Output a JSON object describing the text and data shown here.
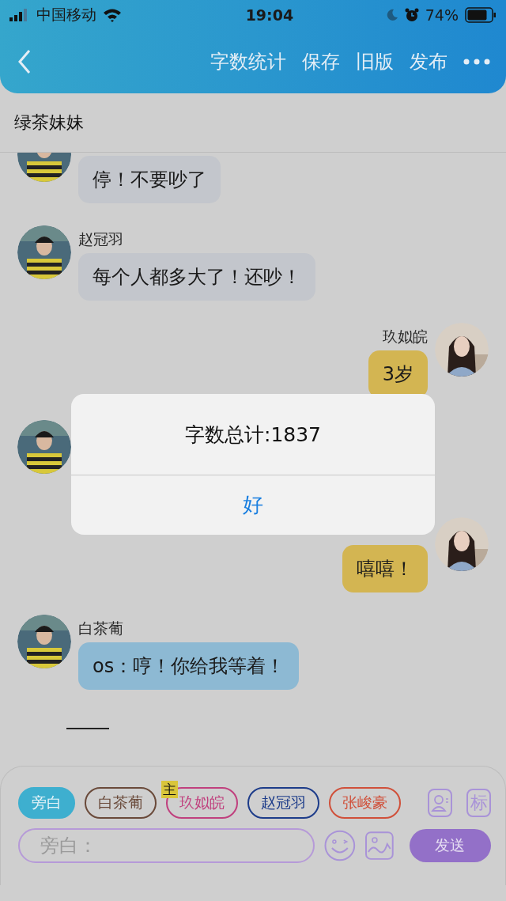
{
  "status_bar": {
    "carrier": "中国移动",
    "time": "19:04",
    "battery": "74%"
  },
  "header": {
    "actions": [
      "字数统计",
      "保存",
      "旧版",
      "发布"
    ]
  },
  "title": "绿茶妹妹",
  "messages": [
    {
      "kind": "incoming",
      "text": "停！不要吵了",
      "color": "#c3c6cc"
    },
    {
      "kind": "incoming",
      "name": "赵冠羽",
      "text": "每个人都多大了！还吵！",
      "color": "#c3c6cc"
    },
    {
      "kind": "outgoing",
      "name": "玖姒皖",
      "text": "3岁",
      "color": "#d3b552"
    },
    {
      "kind": "incoming"
    },
    {
      "kind": "outgoing",
      "text": "嘻嘻！",
      "color": "#d3b552"
    },
    {
      "kind": "incoming",
      "name": "白茶葡",
      "text": "os：哼！你给我等着！",
      "color": "#8db9d3"
    }
  ],
  "dialog": {
    "title": "字数总计:1837",
    "button": "好"
  },
  "composer": {
    "chips": [
      {
        "label": "旁白",
        "color": "#3eafcf",
        "selected": true
      },
      {
        "label": "白茶葡",
        "color": "#6a4a3a",
        "selected": false
      },
      {
        "label": "玖姒皖",
        "color": "#c0407e",
        "selected": false,
        "badge": "主"
      },
      {
        "label": "赵冠羽",
        "color": "#1d3c8a",
        "selected": false
      },
      {
        "label": "张峻豪",
        "color": "#d0503a",
        "selected": false
      }
    ],
    "tag_button": "标",
    "placeholder": "旁白：",
    "send": "发送"
  }
}
